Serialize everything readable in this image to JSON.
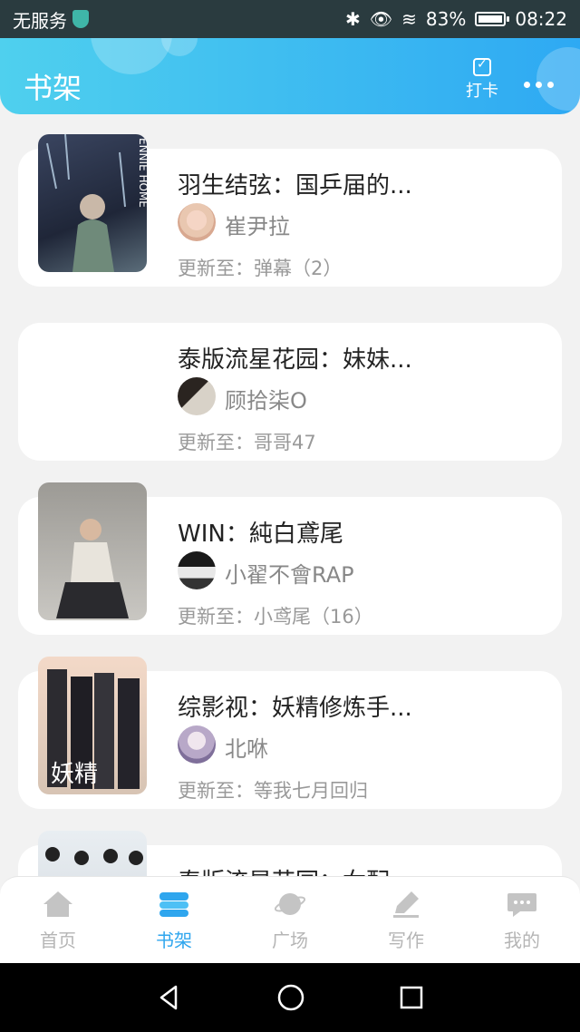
{
  "status_bar": {
    "carrier": "无服务",
    "battery": "83%",
    "time": "08:22",
    "battery_level": 0.83
  },
  "header": {
    "title": "书架",
    "checkin_label": "打卡"
  },
  "books": [
    {
      "title": "羽生结弦：国乒届的...",
      "author": "崔尹拉",
      "update": "更新至：弹幕（2）",
      "cover_text": "ENNIE HOME"
    },
    {
      "title": "泰版流星花园：妹妹...",
      "author": "顾拾柒O",
      "update": "更新至：哥哥47"
    },
    {
      "title": "WIN：純白鳶尾",
      "author": "小翟不會RAP",
      "update": "更新至：小鸢尾（16）"
    },
    {
      "title": "综影视：妖精修炼手...",
      "author": "北咻",
      "update": "更新至：等我七月回归",
      "cover_text": "妖精"
    },
    {
      "title": "泰版流星花园：女配"
    }
  ],
  "tabs": [
    {
      "label": "首页",
      "icon": "home-icon"
    },
    {
      "label": "书架",
      "icon": "bookshelf-icon"
    },
    {
      "label": "广场",
      "icon": "planet-icon"
    },
    {
      "label": "写作",
      "icon": "pen-icon"
    },
    {
      "label": "我的",
      "icon": "chat-bubble-icon"
    }
  ],
  "colors": {
    "accent": "#2fa6ee",
    "header_start": "#4fd0ee",
    "header_end": "#2ea9f3"
  }
}
